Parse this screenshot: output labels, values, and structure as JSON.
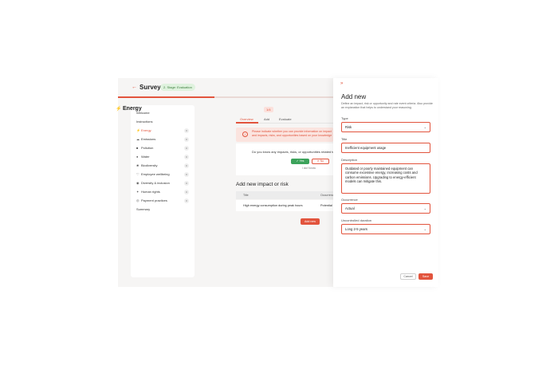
{
  "header": {
    "back_icon": "arrow-left-icon",
    "title": "Survey",
    "stage_badge": "2. Stage: Evaluation",
    "progress": 0.3
  },
  "sidebar": {
    "items": [
      {
        "label": "Welcome",
        "icon": "",
        "count": ""
      },
      {
        "label": "Instructions",
        "icon": "",
        "count": ""
      },
      {
        "label": "Energy",
        "icon": "bolt-icon",
        "count": "0"
      },
      {
        "label": "Emissions",
        "icon": "cloud-icon",
        "count": "0"
      },
      {
        "label": "Pollution",
        "icon": "factory-icon",
        "count": "0"
      },
      {
        "label": "Water",
        "icon": "droplet-icon",
        "count": "0"
      },
      {
        "label": "Biodiversity",
        "icon": "leaf-icon",
        "count": "0"
      },
      {
        "label": "Employee wellbeing",
        "icon": "heart-icon",
        "count": "0"
      },
      {
        "label": "Diversity & inclusion",
        "icon": "people-icon",
        "count": "0"
      },
      {
        "label": "Human rights",
        "icon": "person-icon",
        "count": "0"
      },
      {
        "label": "Payment practices",
        "icon": "coins-icon",
        "count": "0"
      },
      {
        "label": "Summary",
        "icon": "",
        "count": ""
      }
    ],
    "active_index": 2
  },
  "main": {
    "title": "Energy",
    "badge": "1/4",
    "tabs": [
      {
        "label": "Overview"
      },
      {
        "label": "Add"
      },
      {
        "label": "Evaluate"
      }
    ],
    "alert_text_line1": "Please indicate whether you can provide information on impacts, risks, and opportunities related to",
    "alert_text_line2": "and impacts, risks, and opportunities based on your knowledge.",
    "question": "Do you know any impacts, risks, or opportunities related to",
    "yes_label": "✓ Yes",
    "no_label": "✕ No",
    "dont_know": "I don't know",
    "section_title": "Add new impact or risk",
    "table": {
      "headers": [
        "Title",
        "Occurrence"
      ],
      "rows": [
        [
          "High energy consumption during peak hours",
          "Potential"
        ]
      ]
    },
    "add_new_button": "Add new"
  },
  "drawer": {
    "close_icon": "double-chevron-right-icon",
    "title": "Add new",
    "description": "Define an impact, risk or opportunity and rate event criteria. Also provide an explanation that helps to understand your reasoning.",
    "type_label": "Type",
    "type_value": "Risk",
    "title_label": "Title",
    "title_value": "Inefficient equipment usage",
    "description_label": "Description",
    "description_value": "Outdated or poorly maintained equipment can consume excessive energy, increasing costs and carbon emissions. Upgrading to energy-efficient models can mitigate this.",
    "occurrence_label": "Occurrence",
    "occurrence_value": "Actual",
    "duration_label": "Uncontrolled duration",
    "duration_value": "Long 2-5 years",
    "cancel_label": "Cancel",
    "save_label": "Save"
  },
  "colors": {
    "accent": "#e2543d",
    "success": "#3ca35b",
    "alert_bg": "#fbe4df"
  }
}
